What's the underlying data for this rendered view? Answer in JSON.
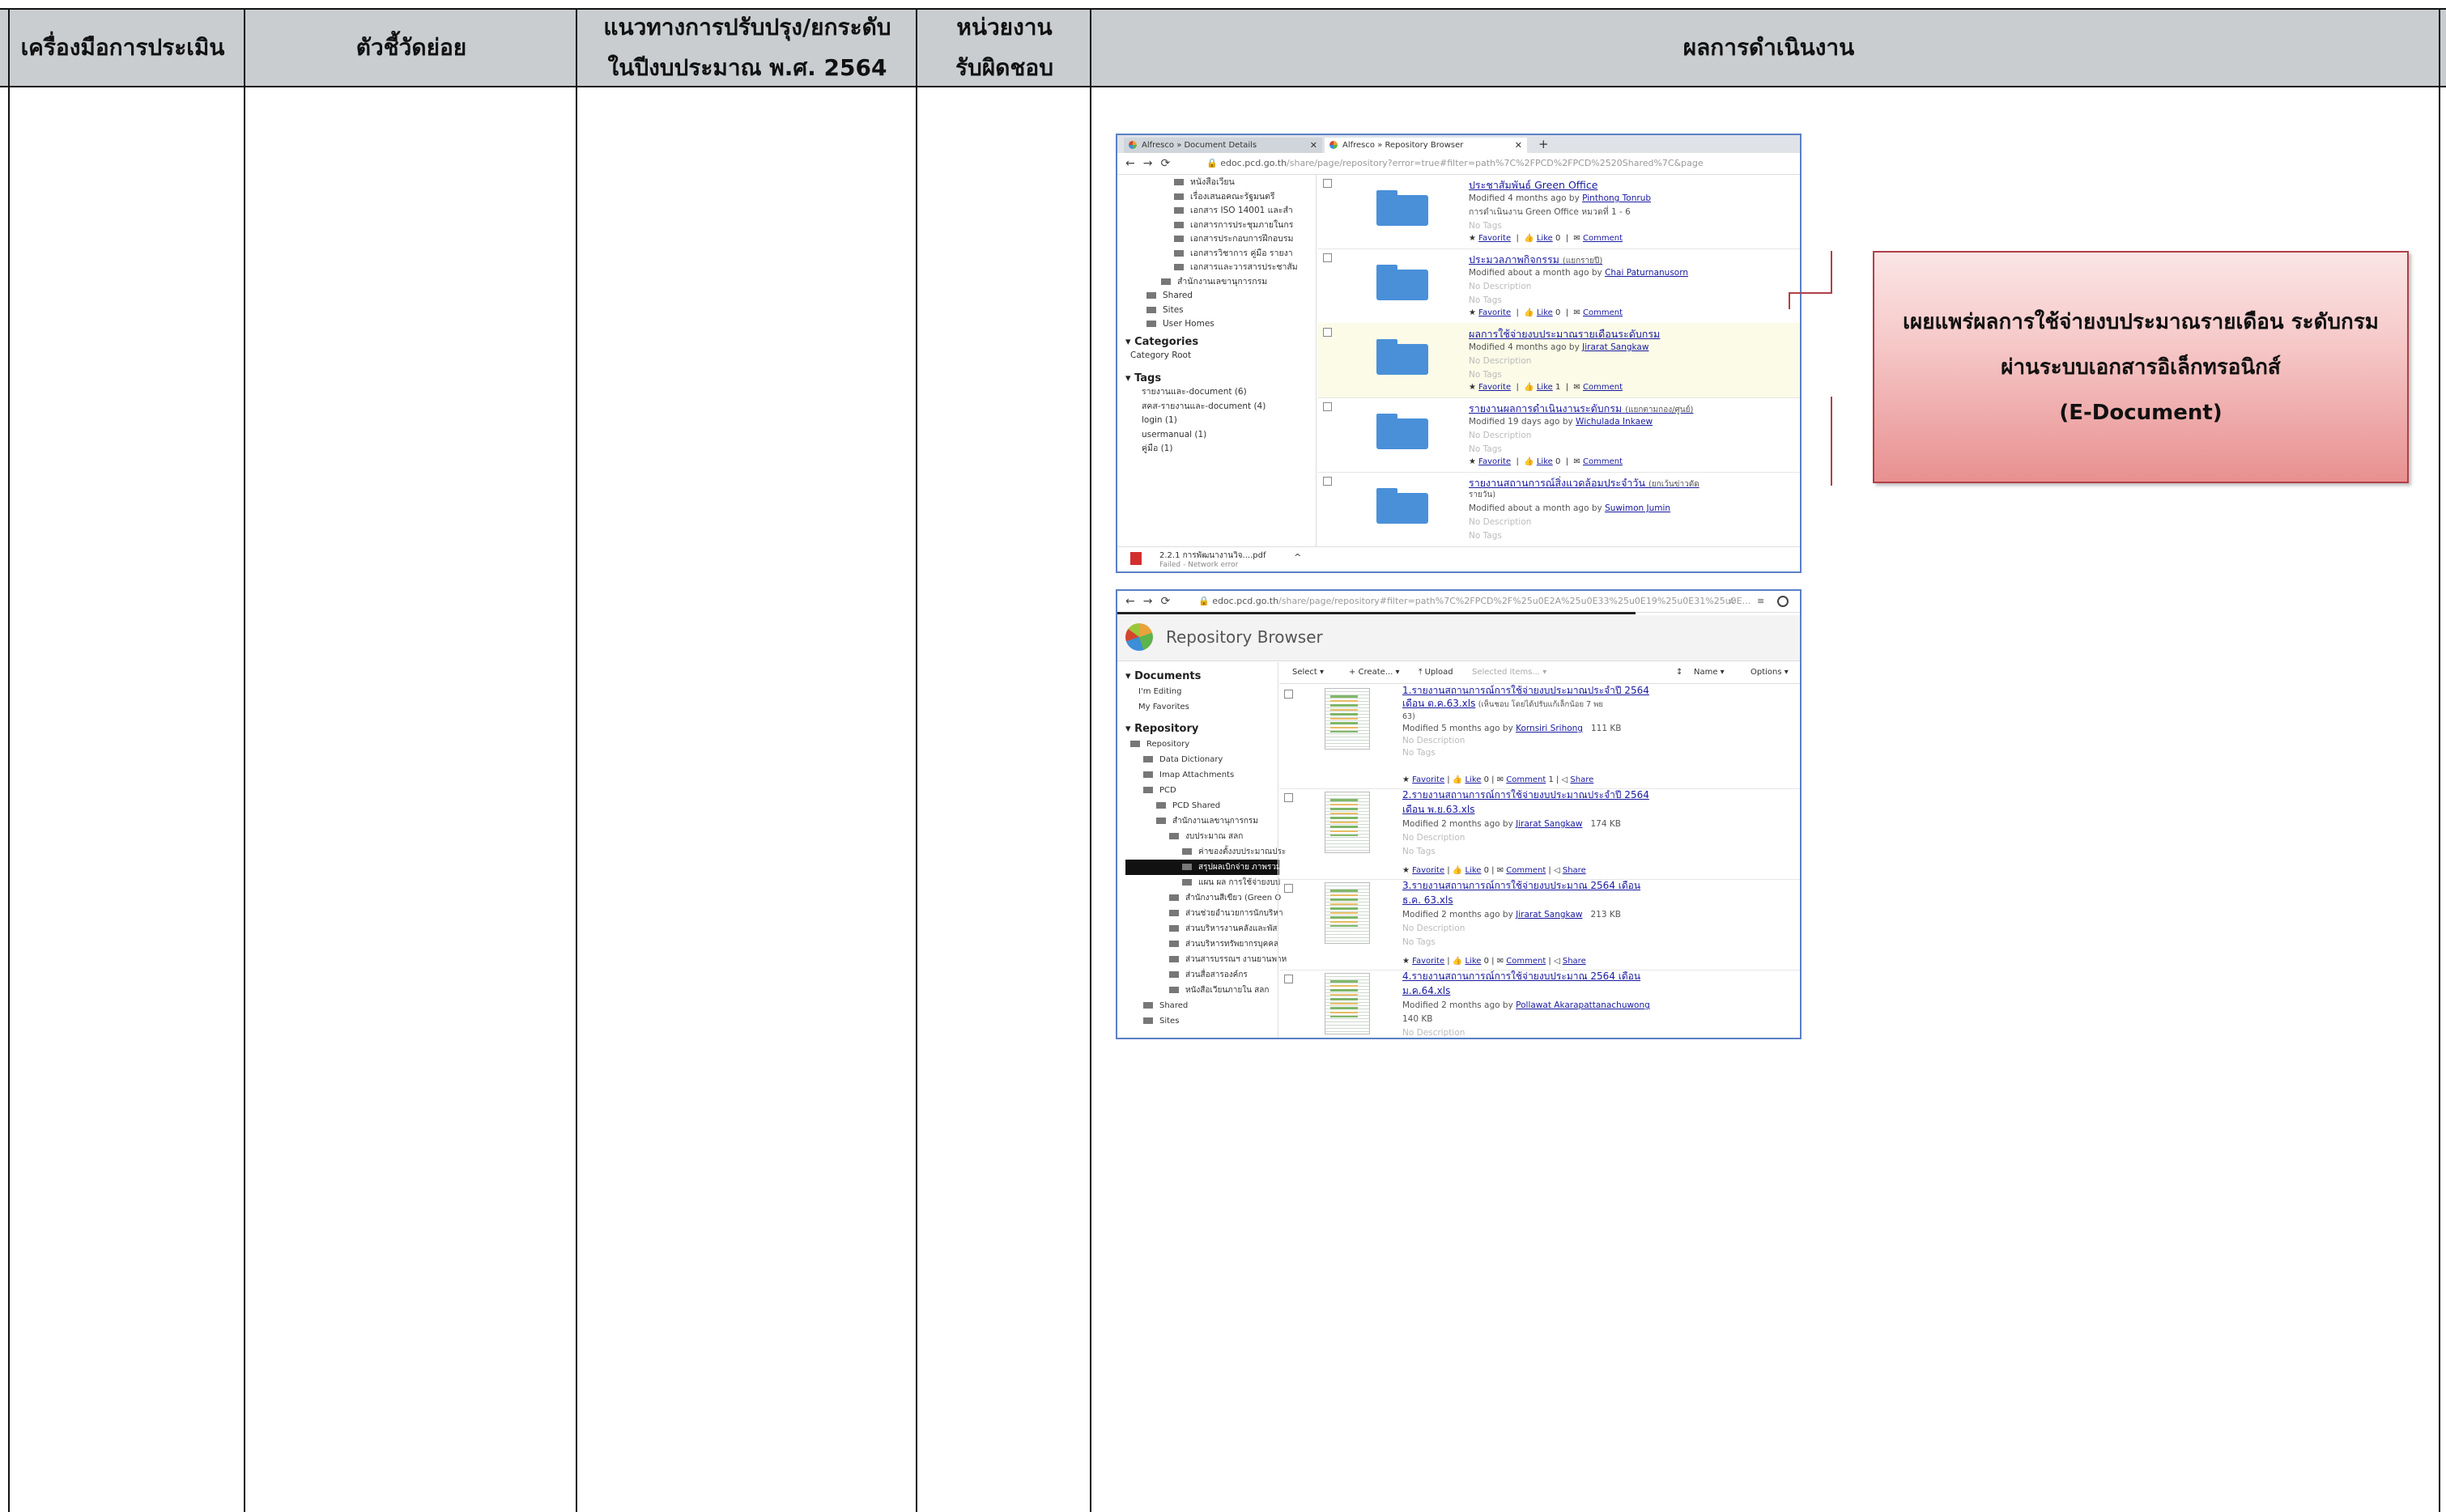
{
  "table": {
    "headers": [
      "เครื่องมือการประเมิน",
      "ตัวชี้วัดย่อย",
      "แนวทางการปรับปรุง/ยกระดับ",
      "ในปีงบประมาณ พ.ศ. 2564",
      "หน่วยงาน",
      "รับผิดชอบ",
      "ผลการดำเนินงาน"
    ]
  },
  "screenshot1": {
    "tabs": [
      "Alfresco » Document Details",
      "Alfresco » Repository Browser"
    ],
    "url_host": "edoc.pcd.go.th",
    "url_path": "/share/page/repository?error=true#filter=path%7C%2FPCD%2FPCD%2520Shared%7C&page",
    "tree": [
      "หนังสือเวียน",
      "เรื่องเสนอคณะรัฐมนตรี",
      "เอกสาร ISO 14001 และสำ",
      "เอกสารการประชุมภายในกร",
      "เอกสารประกอบการฝึกอบรม",
      "เอกสารวิชาการ คู่มือ รายงา",
      "เอกสารและวารสารประชาสัม",
      "สำนักงานเลขานุการกรม",
      "Shared",
      "Sites",
      "User Homes"
    ],
    "categories_label": "Categories",
    "category_root": "Category Root",
    "tags_label": "Tags",
    "tags": [
      "รายงานและ-document (6)",
      "สคส-รายงานและ-document (4)",
      "login (1)",
      "usermanual (1)",
      "คู่มือ (1)"
    ],
    "download_file": "2.2.1 การพัฒนางานวิจ....pdf",
    "download_status": "Failed - Network error",
    "rows": [
      {
        "title": "ประชาสัมพันธ์ Green Office",
        "suffix": "",
        "modified": "Modified 4 months ago by",
        "user": "Pinthong Tonrub",
        "desc": "การดำเนินงาน Green Office หมวดที่ 1 - 6",
        "tags": "No Tags",
        "likes": "0"
      },
      {
        "title": "ประมวลภาพกิจกรรม",
        "suffix": "(แยกรายปี)",
        "modified": "Modified about a month ago by",
        "user": "Chai Paturnanusorn",
        "desc": "No Description",
        "tags": "No Tags",
        "likes": "0"
      },
      {
        "title": "ผลการใช้จ่ายงบประมาณรายเดือนระดับกรม",
        "suffix": "",
        "modified": "Modified 4 months ago by",
        "user": "Jirarat Sangkaw",
        "desc": "No Description",
        "tags": "No Tags",
        "likes": "1"
      },
      {
        "title": "รายงานผลการดำเนินงานระดับกรม",
        "suffix": "(แยกตามกอง/ศูนย์)",
        "modified": "Modified 19 days ago by",
        "user": "Wichulada Inkaew",
        "desc": "No Description",
        "tags": "No Tags",
        "likes": "0"
      },
      {
        "title": "รายงานสถานการณ์สิ่งแวดล้อมประจำวัน",
        "suffix": "(ยกเว้นข่าวตัด",
        "suffix2": "รายวัน)",
        "modified": "Modified about a month ago by",
        "user": "Suwimon Jumin",
        "desc": "No Description",
        "tags": "No Tags"
      }
    ],
    "actions": {
      "favorite": "Favorite",
      "like": "Like",
      "comment": "Comment"
    }
  },
  "screenshot2": {
    "url_host": "edoc.pcd.go.th",
    "url_path": "/share/page/repository#filter=path%7C%2FPCD%2F%25u0E2A%25u0E33%25u0E19%25u0E31%25u0E...",
    "app_title": "Repository Browser",
    "toolbar": {
      "select": "Select ▾",
      "create": "+ Create... ▾",
      "upload": "⤒ Upload",
      "selected": "Selected Items... ▾",
      "sort": "Name ▾",
      "options": "Options ▾"
    },
    "documents_label": "Documents",
    "doc_items": [
      "I'm Editing",
      "My Favorites"
    ],
    "repository_label": "Repository",
    "repo_tree": [
      "Repository",
      "Data Dictionary",
      "Imap Attachments",
      "PCD",
      "PCD Shared",
      "สำนักงานเลขานุการกรม",
      "งบประมาณ สลก",
      "ค่าของตั้งงบประมาณประ",
      "สรุปผลเบิกจ่าย ภาพรวม",
      "แผน ผล การใช้จ่ายงบป",
      "สำนักงานสีเขียว (Green O",
      "ส่วนช่วยอำนวยการนักบริหา",
      "ส่วนบริหารงานคลังและพัส",
      "ส่วนบริหารทรัพยากรบุคคล",
      "ส่วนสารบรรณฯ งานยานพาห",
      "ส่วนสื่อสารองค์กร",
      "หนังสือเวียนภายใน สลก",
      "Shared",
      "Sites"
    ],
    "rows": [
      {
        "title": "1.รายงานสถานการณ์การใช้จ่ายงบประมาณประจำปี 2564",
        "title2": "เดือน ต.ค.63.xls",
        "note": "(เห็นชอบ โดยได้ปรับแก้เล็กน้อย 7 พย",
        "note2": "63)",
        "modified": "Modified 5 months ago by",
        "user": "Kornsiri Srihong",
        "size": "111 KB",
        "comments": "1"
      },
      {
        "title": "2.รายงานสถานการณ์การใช้จ่ายงบประมาณประจำปี 2564",
        "title2": "เดือน พ.ย.63.xls",
        "modified": "Modified 2 months ago by",
        "user": "Jirarat Sangkaw",
        "size": "174 KB"
      },
      {
        "title": "3.รายงานสถานการณ์การใช้จ่ายงบประมาณ 2564 เดือน",
        "title2": "ธ.ค. 63.xls",
        "modified": "Modified 2 months ago by",
        "user": "Jirarat Sangkaw",
        "size": "213 KB"
      },
      {
        "title": "4.รายงานสถานการณ์การใช้จ่ายงบประมาณ 2564 เดือน",
        "title2": "ม.ค.64.xls",
        "modified": "Modified 2 months ago by",
        "user": "Pollawat Akarapattanachuwong",
        "size": "140 KB"
      }
    ],
    "no_description": "No Description",
    "no_tags": "No Tags",
    "actions": {
      "favorite": "Favorite",
      "like": "Like",
      "comment": "Comment",
      "share": "Share"
    }
  },
  "callout": {
    "line1": "เผยแพร่ผลการใช้จ่ายงบประมาณรายเดือน ระดับกรม",
    "line2": "ผ่านระบบเอกสารอิเล็กทรอนิกส์",
    "line3": "(E-Document)"
  }
}
